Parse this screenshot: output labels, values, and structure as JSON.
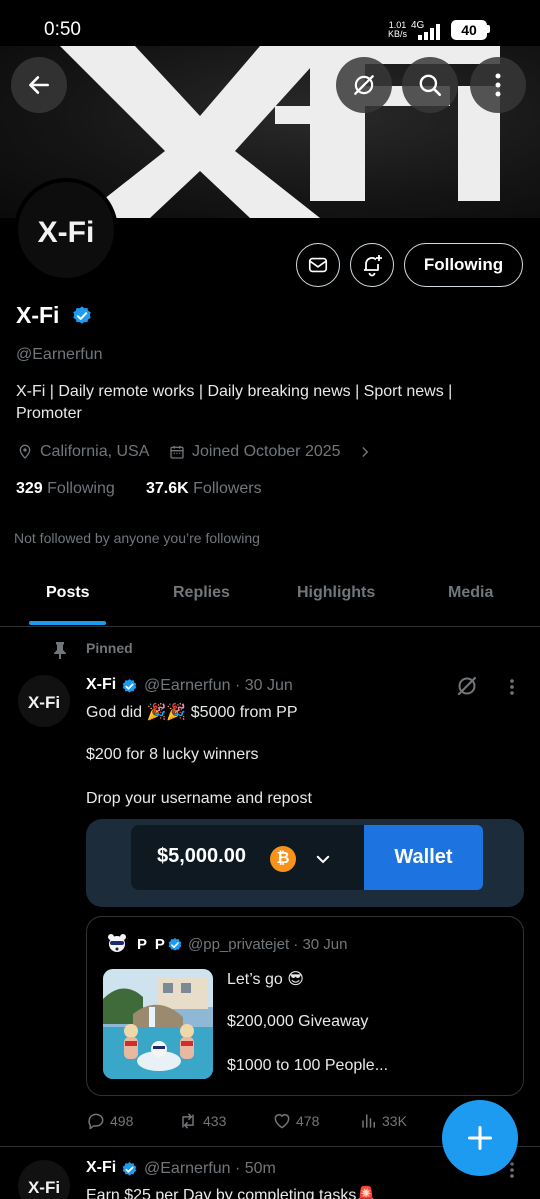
{
  "status_bar": {
    "time": "0:50",
    "net_speed_value": "1.01",
    "net_speed_unit": "KB/s",
    "network": "4G",
    "battery": "40"
  },
  "header": {
    "back_icon": "arrow-left-icon",
    "grok_icon": "grok-icon",
    "search_icon": "search-icon",
    "more_icon": "more-vertical-icon",
    "banner_text": "X-Fi"
  },
  "profile": {
    "avatar_text": "X-Fi",
    "display_name": "X-Fi",
    "handle": "@Earnerfun",
    "bio": "X-Fi | Daily remote works | Daily breaking news | Sport news | Promoter",
    "location": "California, USA",
    "joined": "Joined October 2025",
    "following_count": "329",
    "following_label": "Following",
    "followers_count": "37.6K",
    "followers_label": "Followers",
    "not_followed": "Not followed by anyone you’re following",
    "follow_button": "Following",
    "accent_color": "#1d9bf0"
  },
  "tabs": [
    {
      "label": "Posts",
      "active": true
    },
    {
      "label": "Replies"
    },
    {
      "label": "Highlights"
    },
    {
      "label": "Media"
    }
  ],
  "post1": {
    "pinned_label": "Pinned",
    "name": "X-Fi",
    "handle_time": "@Earnerfun · 30 Jun",
    "lines": [
      "God did 🎉🎉 $5000 from PP",
      "$200 for 8 lucky winners",
      "Drop your username and repost"
    ],
    "wallet": {
      "amount": "$5,000.00",
      "coin_symbol": "₿",
      "button": "Wallet"
    },
    "quote": {
      "name": "P P",
      "handle_time": "@pp_privatejet · 30 Jun",
      "lines": [
        "Let’s go 😎",
        "$200,000 Giveaway",
        "$1000 to 100 People..."
      ]
    },
    "actions": {
      "replies": "498",
      "reposts": "433",
      "likes": "478",
      "views": "33K"
    }
  },
  "post2": {
    "name": "X-Fi",
    "handle_time": "@Earnerfun · 50m",
    "line1": "Earn $25 per Day by completing tasks🚨"
  }
}
